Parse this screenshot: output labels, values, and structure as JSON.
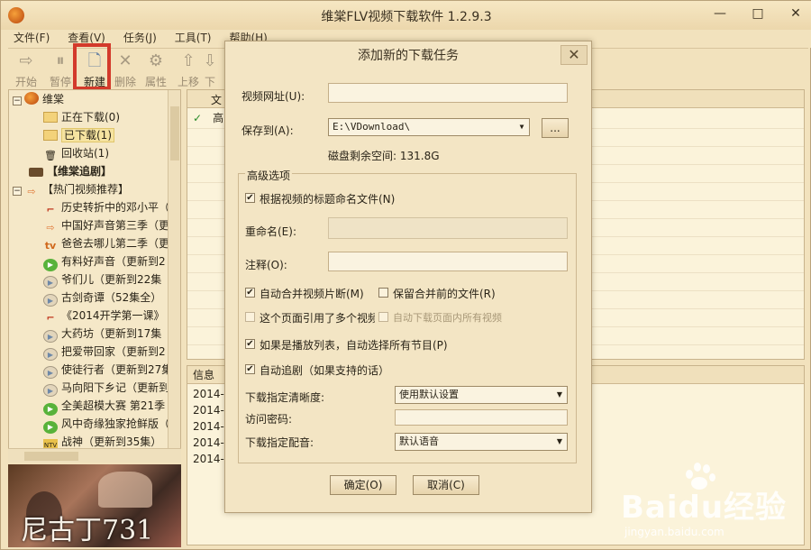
{
  "titlebar": {
    "title": "维棠FLV视频下载软件 1.2.9.3",
    "minimize": "—",
    "maximize": "□",
    "close": "✕"
  },
  "menu": [
    "文件(F)",
    "查看(V)",
    "任务(J)",
    "工具(T)",
    "帮助(H)"
  ],
  "toolbar": [
    {
      "label": "开始",
      "icon": "play-arrow-icon",
      "glyph": "⇨"
    },
    {
      "label": "暂停",
      "icon": "pause-icon",
      "glyph": "⏸"
    },
    {
      "label": "新建",
      "icon": "new-document-icon",
      "glyph": "🗋"
    },
    {
      "label": "删除",
      "icon": "delete-icon",
      "glyph": "✕"
    },
    {
      "label": "属性",
      "icon": "properties-icon",
      "glyph": "⚙"
    },
    {
      "label": "上移",
      "icon": "move-up-icon",
      "glyph": "⇧"
    },
    {
      "label": "下",
      "icon": "move-down-icon",
      "glyph": "⇩"
    }
  ],
  "sidebar": {
    "root": "维棠",
    "items": [
      {
        "label": "正在下载(0)",
        "icon": "folder-icon"
      },
      {
        "label": "已下载(1)",
        "icon": "folder-icon"
      },
      {
        "label": "回收站(1)",
        "icon": "recycle-bin-icon"
      }
    ],
    "drama": "【维棠追剧】",
    "hot": "【热门视频推荐】",
    "videos": [
      {
        "label": "历史转折中的邓小平（",
        "icon": "red-mark-icon"
      },
      {
        "label": "中国好声音第三季（更",
        "icon": "orange-arrow-icon"
      },
      {
        "label": "爸爸去哪儿第二季（更",
        "icon": "tv-icon"
      },
      {
        "label": "有料好声音（更新到2",
        "icon": "green-play-icon"
      },
      {
        "label": "爷们儿（更新到22集",
        "icon": "play-icon"
      },
      {
        "label": "古剑奇谭（52集全）",
        "icon": "play-icon"
      },
      {
        "label": "《2014开学第一课》",
        "icon": "red-mark-icon"
      },
      {
        "label": "大药坊（更新到17集",
        "icon": "play-icon"
      },
      {
        "label": "把爱带回家（更新到2",
        "icon": "play-icon"
      },
      {
        "label": "使徒行者（更新到27集",
        "icon": "play-icon"
      },
      {
        "label": "马向阳下乡记（更新到",
        "icon": "play-icon"
      },
      {
        "label": "全美超模大赛 第21季",
        "icon": "green-play-icon"
      },
      {
        "label": "风中奇缘独家抢鲜版（",
        "icon": "green-play-icon"
      },
      {
        "label": "战神（更新到35集）",
        "icon": "tv-icon"
      }
    ]
  },
  "preview": {
    "caption": "尼古丁731"
  },
  "task_list": {
    "column": "文",
    "row_check": "✓",
    "row_text": "高"
  },
  "info": {
    "header": "信息",
    "rows": [
      "2014-",
      "2014-",
      "2014-",
      "2014-",
      "2014-"
    ]
  },
  "dialog": {
    "title": "添加新的下载任务",
    "close": "✕",
    "url_label": "视频网址(U):",
    "url_value": "",
    "save_label": "保存到(A):",
    "save_value": "E:\\VDownload\\",
    "browse": "...",
    "disk_space": "磁盘剩余空间: 131.8G",
    "advanced": "高级选项",
    "name_by_title": "根据视频的标题命名文件(N)",
    "rename_label": "重命名(E):",
    "note_label": "注释(O):",
    "auto_merge": "自动合并视频片断(M)",
    "keep_before_merge": "保留合并前的文件(R)",
    "multi_video": "这个页面引用了多个视频",
    "auto_download_all": "自动下载页面内所有视频",
    "playlist": "如果是播放列表，自动选择所有节目(P)",
    "auto_follow": "自动追剧（如果支持的话）",
    "quality_label": "下载指定清晰度:",
    "quality_value": "使用默认设置",
    "password_label": "访问密码:",
    "audio_label": "下载指定配音:",
    "audio_value": "默认语音",
    "ok": "确定(O)",
    "cancel": "取消(C)"
  },
  "watermark": {
    "brand": "Baidu经验",
    "url": "jingyan.baidu.com"
  }
}
